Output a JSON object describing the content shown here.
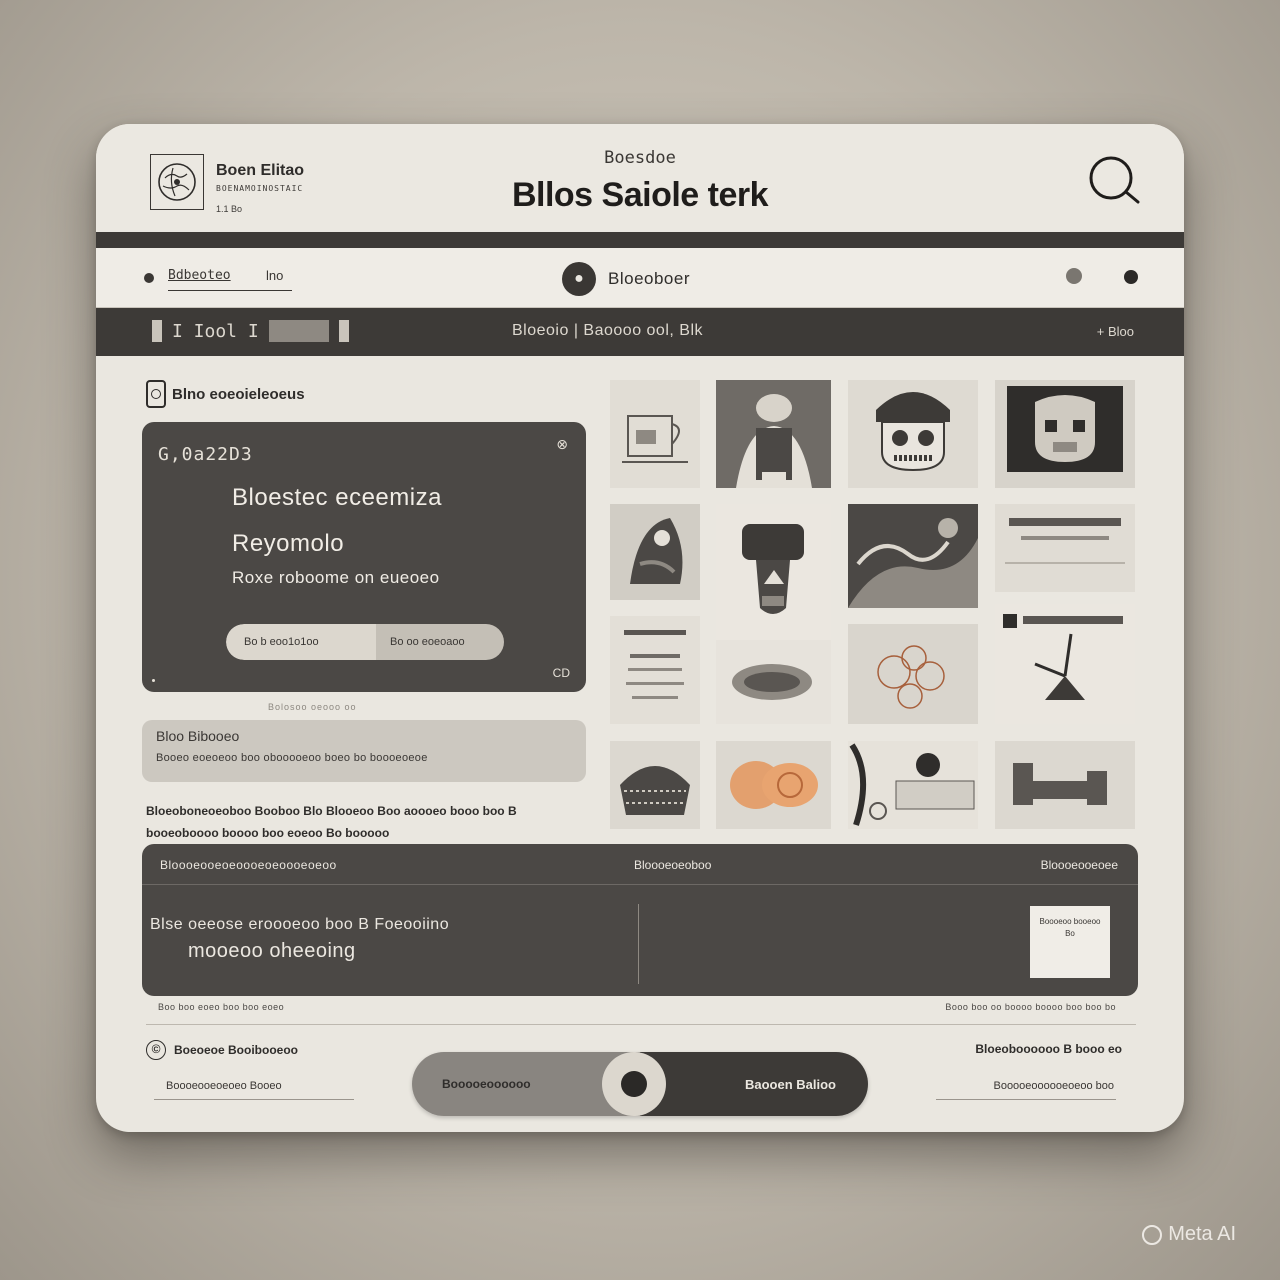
{
  "header": {
    "brand": "Boen Elitao",
    "brand_sub": "BOENAMOINOSTAIC",
    "brand_version": "1.1 Bo",
    "kicker": "Boesdoe",
    "title": "Bllos Saiole terk"
  },
  "address_bar": {
    "tab_label": "Bdbeoteo",
    "tab_secondary": "lno",
    "center_label": "Bloeoboer"
  },
  "toolbar": {
    "left_text": "I Iool I",
    "center_text": "Bloeoio | Baoooo ool, Blk",
    "right_text": "+ Bloo"
  },
  "sidebar": {
    "section_title": "Blno eoeoieleoeus",
    "card": {
      "code": "G,0a22D3",
      "corner_icon": "⊗",
      "line1": "Bloestec eceemiza",
      "line2": "Reyomolo",
      "line3": "Roxe roboome on eueoeo",
      "pill_left": "Bo b eoo1o1oo",
      "pill_right": "Bo oo eoeoaoo",
      "bottom_right": "CD"
    },
    "caption": "Bolosoo oeooo oo",
    "info_box": {
      "title": "Bloo Bibooeo",
      "text": "Booeo eoeoeoo boo obooooeoo boeo bo boooeoeoe"
    },
    "paragraph": "Bloeoboneoeoboo Booboo Blo Blooeoo Boo aoooeo booo boo B booeoboooo boooo boo eoeoo Bo booooo"
  },
  "bottom_panel": {
    "head_left": "Bloooeooeoeoooeoeoooeoeoo",
    "head_center": "Bloooeoeoboo",
    "head_right": "Bloooeooeoee",
    "lead_line1": "Blse oeeose eroooeoo boo B Foeooiino",
    "lead_line2": "mooeoo oheeoing",
    "qr_text": "Boooeoo booeoo Bo"
  },
  "meta_left": "Boo boo eoeo boo boo eoeo",
  "meta_right": "Booo boo oo boooo boooo boo boo bo",
  "footer": {
    "left_title": "Boeoeoe Booibooeoo",
    "left_link": "Boooeooeoeoeo Booeo",
    "right_title": "Bloeoboooooo B booo eo",
    "right_link": "Booooeoooooeoeoo boo",
    "toggle_left": "Booooeoooooo",
    "toggle_right": "Baooen Balioo"
  },
  "watermark": "Meta AI"
}
